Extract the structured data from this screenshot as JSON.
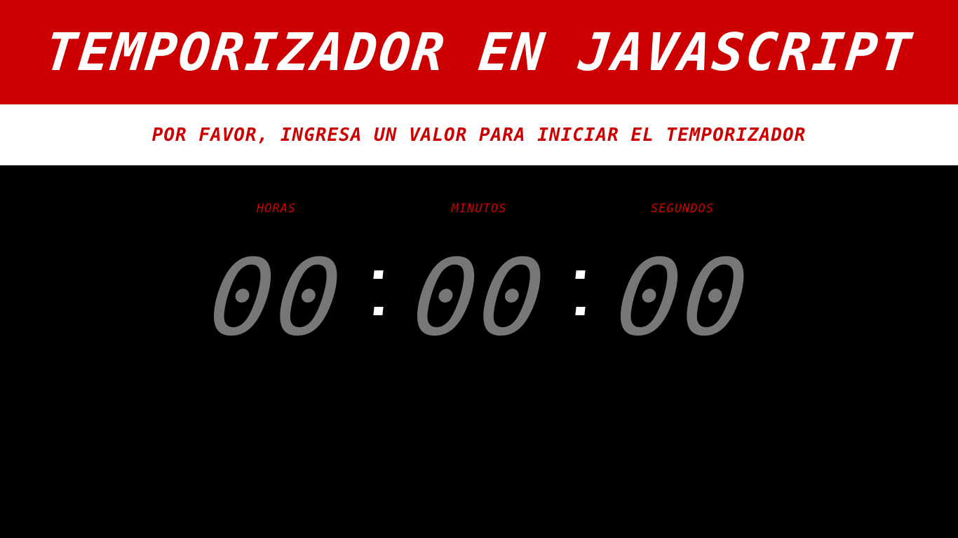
{
  "header": {
    "title": "TEMPORIZADOR EN JAVASCRIPT"
  },
  "message": "POR FAVOR, INGRESA UN VALOR PARA INICIAR EL TEMPORIZADOR",
  "timer": {
    "labels": {
      "hours": "HORAS",
      "minutes": "MINUTOS",
      "seconds": "SEGUNDOS"
    },
    "hours": "00",
    "minutes": "00",
    "seconds": "00"
  },
  "colors": {
    "brand_red": "#cc0000",
    "digit_gray": "#777777",
    "background": "#000000",
    "white": "#ffffff"
  }
}
